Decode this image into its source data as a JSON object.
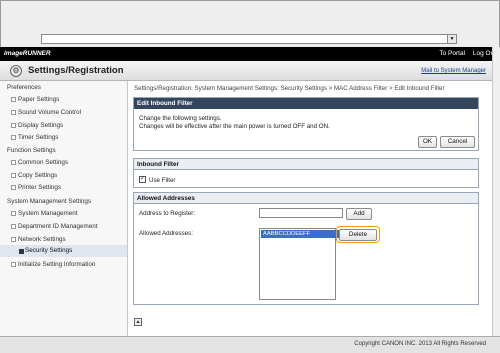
{
  "browser": {
    "url_value": "",
    "dropdown_icon": "chevron-down-icon"
  },
  "header": {
    "brand": "imageRUNNER",
    "to_portal": "To Portal",
    "log_out": "Log Out",
    "title": "Settings/Registration",
    "mail_link": "Mail to System Manager"
  },
  "sidebar": {
    "groups": [
      {
        "label": "Preferences",
        "items": [
          "Paper Settings",
          "Sound Volume Control",
          "Display Settings",
          "Timer Settings"
        ]
      },
      {
        "label": "Function Settings",
        "items": [
          "Common Settings",
          "Copy Settings",
          "Printer Settings"
        ]
      },
      {
        "label": "System Management Settings",
        "items": [
          "System Management",
          "Department ID Management",
          "Network Settings",
          "Security Settings",
          "Initialize Setting Information"
        ]
      }
    ],
    "active_item": "Security Settings"
  },
  "main": {
    "breadcrumb": "Settings/Registration: System Management Settings: Security Settings > MAC Address Filter > Edit Inbound Filter",
    "edit_panel": {
      "heading": "Edit Inbound Filter",
      "line1": "Change the following settings.",
      "line2": "Changes will be effective after the main power is turned OFF and ON.",
      "ok_label": "OK",
      "cancel_label": "Cancel"
    },
    "inbound_filter": {
      "heading": "Inbound Filter",
      "use_filter_label": "Use Filter",
      "use_filter_checked": true,
      "check_mark": "✓"
    },
    "allowed_addresses": {
      "heading": "Allowed Addresses",
      "address_label": "Address to Register:",
      "address_value": "",
      "add_label": "Add",
      "allowed_label": "Allowed Addresses:",
      "list_items": [
        "AABBCCDDEEFF"
      ],
      "delete_label": "Delete"
    }
  },
  "footer": {
    "copyright": "Copyright CANON INC. 2013 All Rights Reserved"
  },
  "colors": {
    "highlight": "#f59a1c",
    "panel_header": "#33465e",
    "selection": "#3a6ec9"
  }
}
